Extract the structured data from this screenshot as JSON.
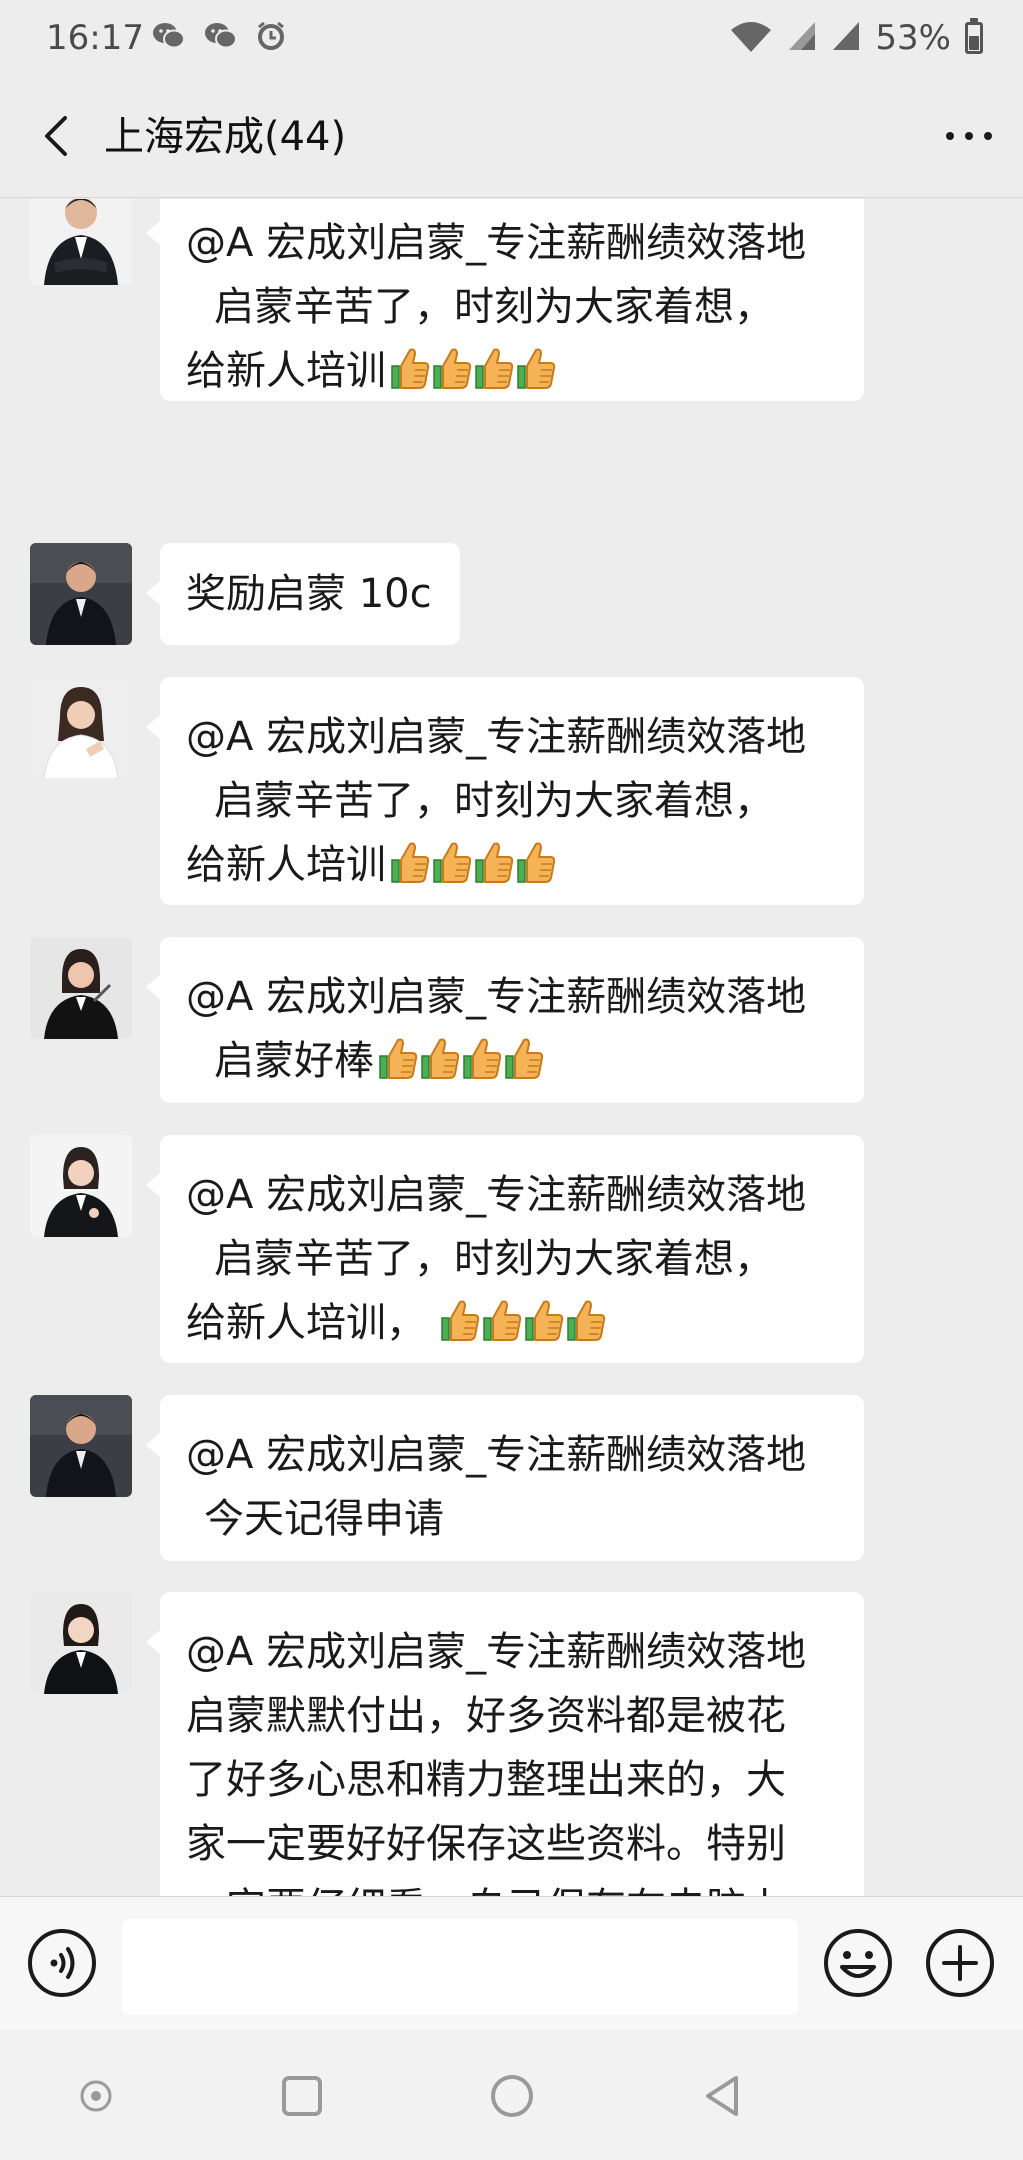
{
  "status_bar": {
    "time": "16:17",
    "battery": "53%",
    "battery_level": 0.53,
    "left_icons": [
      "wechat-icon",
      "wechat-icon",
      "alarm-icon"
    ],
    "right_icons": [
      "wifi-icon",
      "signal-icon",
      "signal-icon",
      "battery-icon"
    ]
  },
  "header": {
    "title": "上海宏成(44)",
    "back_icon": "chevron-left-icon",
    "more_icon": "more-dots-icon"
  },
  "messages": [
    {
      "avatar": "avatar-man-arms-crossed",
      "lines": [
        {
          "text": "@A 宏成刘启蒙_专注薪酬绩效落地",
          "thumbs": 0,
          "indent": false
        },
        {
          "text": "启蒙辛苦了，时刻为大家着想，",
          "thumbs": 0,
          "indent": true
        },
        {
          "text": "给新人培训",
          "thumbs": 4,
          "indent": false
        }
      ]
    },
    {
      "avatar": "avatar-man-suit-seated",
      "lines": [
        {
          "text": "奖励启蒙 10c",
          "thumbs": 0,
          "indent": false
        }
      ]
    },
    {
      "avatar": "avatar-woman-white-blouse",
      "lines": [
        {
          "text": "@A 宏成刘启蒙_专注薪酬绩效落地",
          "thumbs": 0,
          "indent": false
        },
        {
          "text": "启蒙辛苦了，时刻为大家着想，",
          "thumbs": 0,
          "indent": true
        },
        {
          "text": "给新人培训",
          "thumbs": 4,
          "indent": false
        }
      ]
    },
    {
      "avatar": "avatar-woman-black-suit-pen",
      "lines": [
        {
          "text": "@A 宏成刘启蒙_专注薪酬绩效落地",
          "thumbs": 0,
          "indent": false
        },
        {
          "text": "启蒙好棒",
          "thumbs": 4,
          "indent": true
        }
      ]
    },
    {
      "avatar": "avatar-woman-black-suit",
      "lines": [
        {
          "text": "@A 宏成刘启蒙_专注薪酬绩效落地",
          "thumbs": 0,
          "indent": false
        },
        {
          "text": "启蒙辛苦了，时刻为大家着想，",
          "thumbs": 0,
          "indent": true
        },
        {
          "text": "给新人培训，",
          "thumbs": 4,
          "indent": false
        }
      ]
    },
    {
      "avatar": "avatar-man-suit-seated",
      "lines": [
        {
          "text": "@A 宏成刘启蒙_专注薪酬绩效落地",
          "thumbs": 0,
          "indent": false
        },
        {
          "text": "今天记得申请",
          "thumbs": 0,
          "indent": true
        }
      ]
    },
    {
      "avatar": "avatar-woman-black-suit-2",
      "lines": [
        {
          "text": "@A 宏成刘启蒙_专注薪酬绩效落地",
          "thumbs": 0,
          "indent": false
        },
        {
          "text": "启蒙默默付出，好多资料都是被花",
          "thumbs": 0,
          "indent": false
        },
        {
          "text": "了好多心思和精力整理出来的，大",
          "thumbs": 0,
          "indent": false
        },
        {
          "text": "家一定要好好保存这些资料。特别",
          "thumbs": 0,
          "indent": false
        },
        {
          "text": "一定要仔细看，自己保存在电脑上",
          "thumbs": 0,
          "indent": false
        }
      ]
    }
  ],
  "input_bar": {
    "placeholder": "",
    "voice_icon": "voice-icon",
    "emoji_icon": "emoji-icon",
    "plus_icon": "plus-icon"
  },
  "nav_bar": {
    "icons": [
      "nav-dot-icon",
      "recents-icon",
      "home-icon",
      "back-triangle-icon"
    ]
  }
}
